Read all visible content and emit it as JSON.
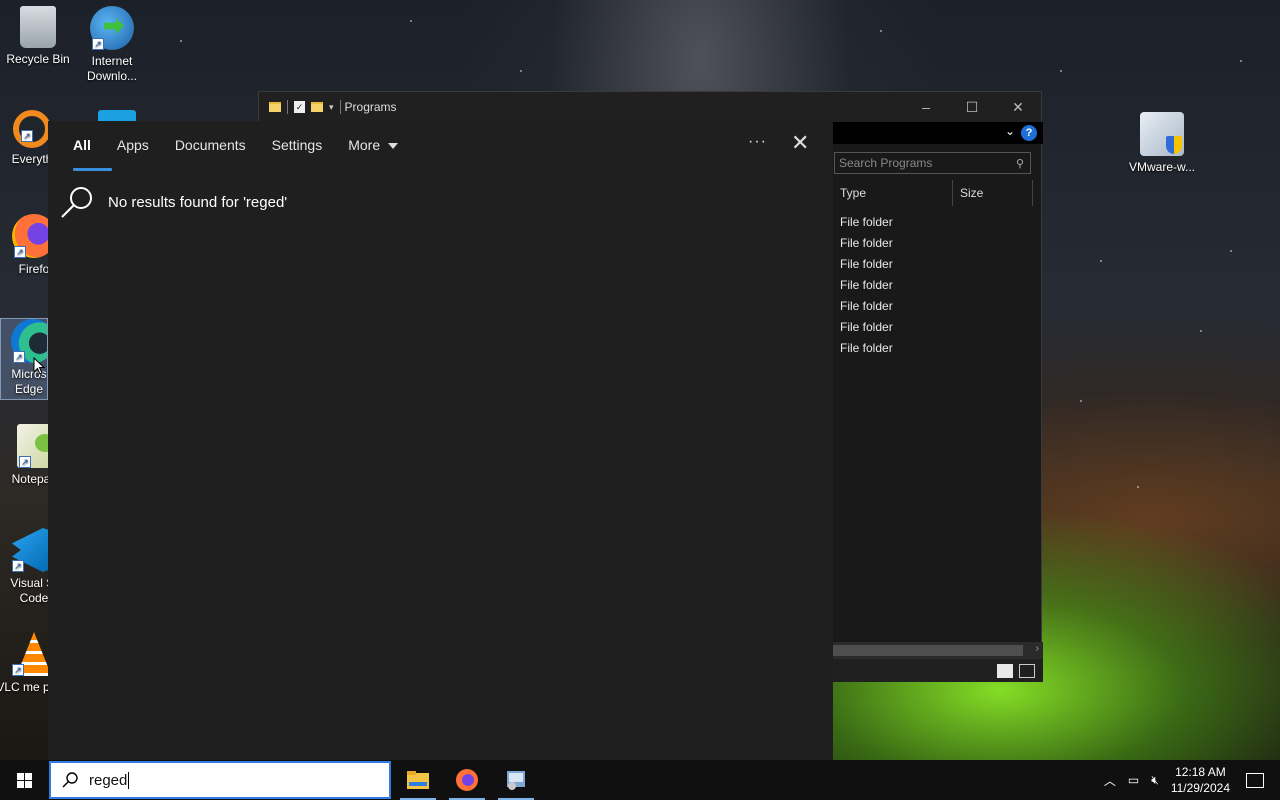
{
  "desktop": {
    "icons": [
      {
        "label": "Recycle Bin",
        "icon": "recycle-bin-icon"
      },
      {
        "label": "Internet Downlo...",
        "icon": "internet-download-manager-icon"
      },
      {
        "label": "Everyth",
        "icon": "everything-search-icon"
      },
      {
        "label": "Firefo",
        "icon": "firefox-icon"
      },
      {
        "label": "Micros Edge",
        "icon": "edge-icon"
      },
      {
        "label": "Notepac",
        "icon": "notepad-plus-plus-icon"
      },
      {
        "label": "Visual St Code",
        "icon": "vscode-icon"
      },
      {
        "label": "VLC me playe",
        "icon": "vlc-icon"
      },
      {
        "label": "VMware-w...",
        "icon": "vmware-icon"
      }
    ]
  },
  "explorer": {
    "title": "Programs",
    "search_placeholder": "Search Programs",
    "columns": [
      "Type",
      "Size"
    ],
    "rows": [
      "File folder",
      "File folder",
      "File folder",
      "File folder",
      "File folder",
      "File folder",
      "File folder"
    ],
    "buttons": {
      "minimize": "–",
      "maximize": "☐",
      "close": "✕"
    }
  },
  "search_flyout": {
    "tabs": [
      "All",
      "Apps",
      "Documents",
      "Settings",
      "More"
    ],
    "active_tab": "All",
    "ellipsis": "···",
    "close": "✕",
    "message": "No results found for 'reged'"
  },
  "taskbar": {
    "search_value": "reged",
    "pinned_apps": [
      "file-explorer-icon",
      "firefox-icon",
      "control-panel-icon"
    ],
    "clock_time": "12:18 AM",
    "clock_date": "11/29/2024"
  },
  "colors": {
    "accent": "#3a8fdc",
    "flyout_bg": "#1f1f1f",
    "taskbar_bg": "#101010"
  }
}
